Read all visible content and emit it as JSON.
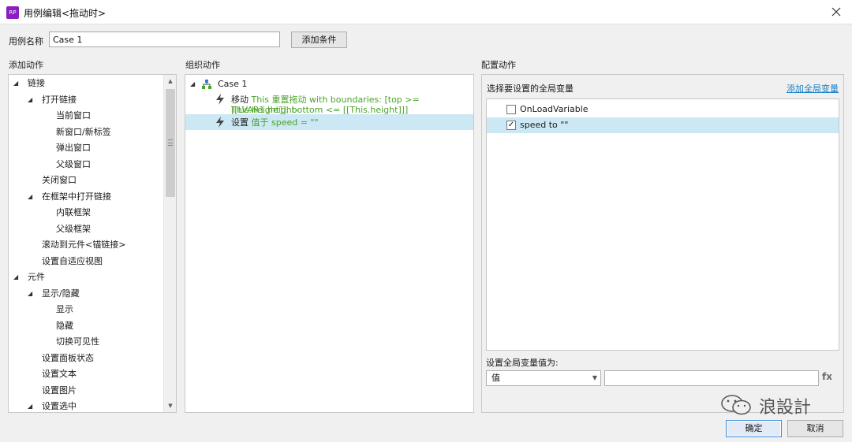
{
  "window": {
    "title": "用例编辑<拖动时>",
    "app_icon_text": "RP"
  },
  "case_name": {
    "label": "用例名称",
    "value": "Case 1"
  },
  "add_condition_label": "添加条件",
  "sections": {
    "add_action": "添加动作",
    "organize_action": "组织动作",
    "configure_action": "配置动作"
  },
  "add_action_tree": [
    {
      "label": "链接",
      "level": 0,
      "expander": "◢"
    },
    {
      "label": "打开链接",
      "level": 1,
      "expander": "◢"
    },
    {
      "label": "当前窗口",
      "level": 2,
      "expander": ""
    },
    {
      "label": "新窗口/新标签",
      "level": 2,
      "expander": ""
    },
    {
      "label": "弹出窗口",
      "level": 2,
      "expander": ""
    },
    {
      "label": "父级窗口",
      "level": 2,
      "expander": ""
    },
    {
      "label": "关闭窗口",
      "level": 1,
      "expander": ""
    },
    {
      "label": "在框架中打开链接",
      "level": 1,
      "expander": "◢"
    },
    {
      "label": "内联框架",
      "level": 2,
      "expander": ""
    },
    {
      "label": "父级框架",
      "level": 2,
      "expander": ""
    },
    {
      "label": "滚动到元件<锚链接>",
      "level": 1,
      "expander": ""
    },
    {
      "label": "设置自适应视图",
      "level": 1,
      "expander": ""
    },
    {
      "label": "元件",
      "level": 0,
      "expander": "◢"
    },
    {
      "label": "显示/隐藏",
      "level": 1,
      "expander": "◢"
    },
    {
      "label": "显示",
      "level": 2,
      "expander": ""
    },
    {
      "label": "隐藏",
      "level": 2,
      "expander": ""
    },
    {
      "label": "切换可见性",
      "level": 2,
      "expander": ""
    },
    {
      "label": "设置面板状态",
      "level": 1,
      "expander": ""
    },
    {
      "label": "设置文本",
      "level": 1,
      "expander": ""
    },
    {
      "label": "设置图片",
      "level": 1,
      "expander": ""
    },
    {
      "label": "设置选中",
      "level": 1,
      "expander": "◢"
    }
  ],
  "organize": {
    "case_label": "Case 1",
    "actions": [
      {
        "verb": "移动",
        "detail_line1": "This 重置拖动 with boundaries: [top >= [[LVAR1.height-",
        "detail_line2": "This.height]], bottom <= [[This.height]]]"
      },
      {
        "verb": "设置",
        "detail_line1": "值于 speed = \"\"",
        "detail_line2": ""
      }
    ]
  },
  "configure": {
    "select_global_label": "选择要设置的全局变量",
    "add_global_link": "添加全局变量",
    "variables": [
      {
        "label": "OnLoadVariable",
        "checked": ""
      },
      {
        "label": "speed to \"\"",
        "checked": "✓"
      }
    ],
    "set_value_label": "设置全局变量值为:",
    "value_type": "值",
    "value_input": "",
    "fx_label": "fx"
  },
  "watermark_text": "浪設計",
  "buttons": {
    "ok": "确定",
    "cancel": "取消"
  },
  "colors": {
    "accent_blue": "#3c8dd4",
    "selection": "#cce8f4",
    "green_text": "#4aa329",
    "link": "#1a7fc8"
  }
}
